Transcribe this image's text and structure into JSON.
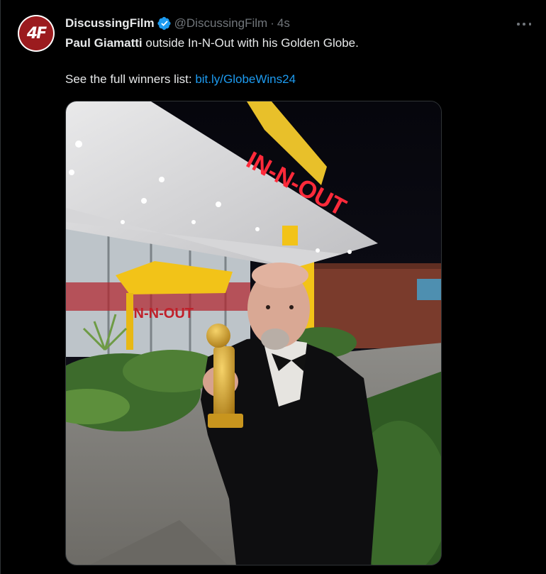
{
  "tweet": {
    "author": {
      "display_name": "DiscussingFilm",
      "handle": "@DiscussingFilm",
      "avatar_text": "4F",
      "verified": true
    },
    "separator": "·",
    "timestamp": "4s",
    "text": {
      "bold_name": "Paul Giamatti",
      "line1_rest": " outside In-N-Out with his Golden Globe.",
      "line2_prefix": "See the full winners list: ",
      "link": "bit.ly/GlobeWins24"
    },
    "media": {
      "sign_text": "IN-N-OUT",
      "store_lettering": "IN-N-OUT"
    }
  },
  "colors": {
    "background": "#000000",
    "text_primary": "#e7e9ea",
    "text_secondary": "#71767b",
    "link": "#1d9bf0",
    "verified": "#1d9bf0",
    "avatar_bg": "#9b1b1e"
  },
  "icons": {
    "verified": "verified-badge-icon",
    "more": "more-horizontal-icon"
  }
}
